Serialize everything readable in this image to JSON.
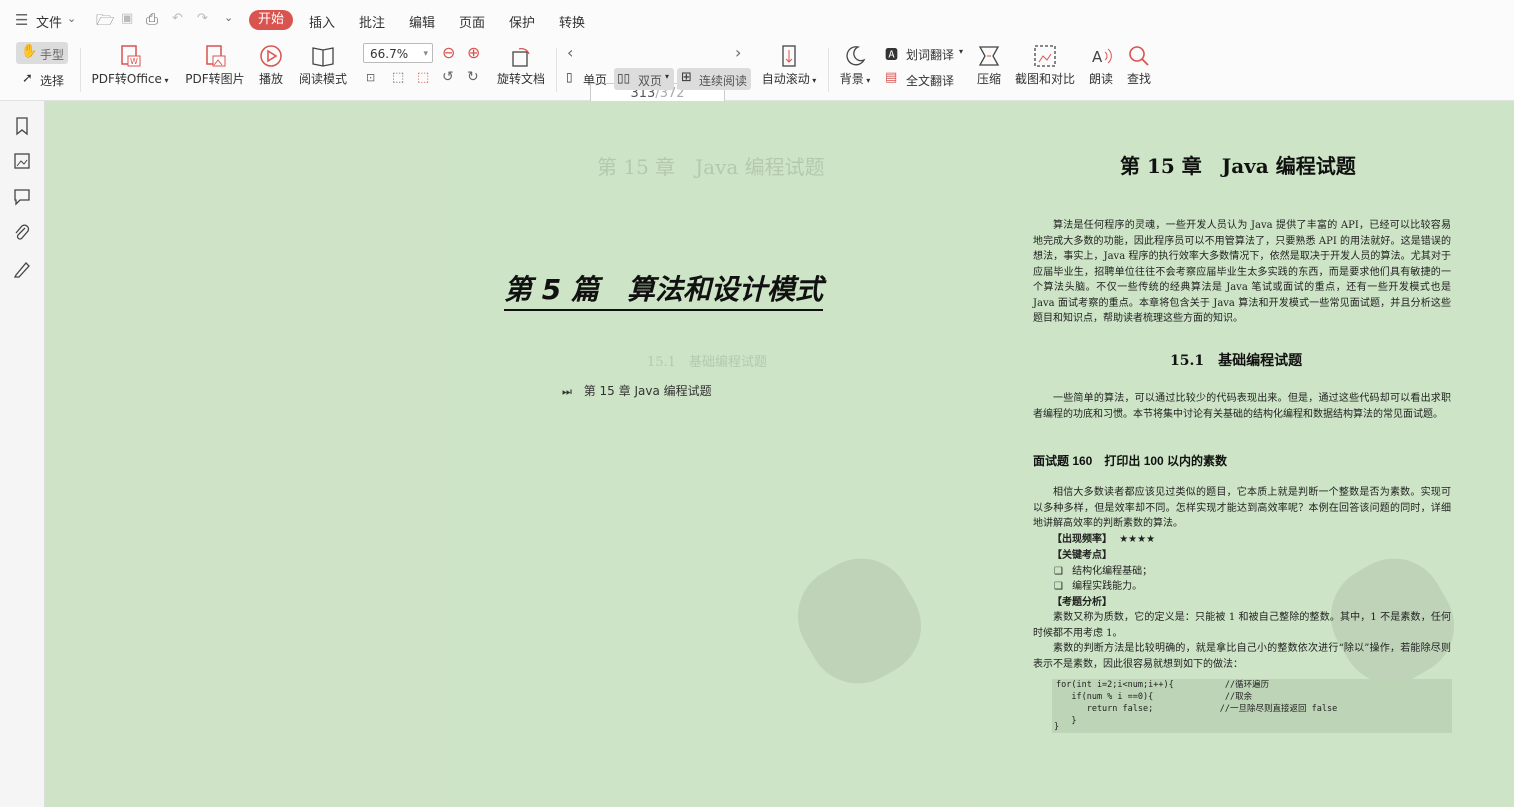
{
  "menu": {
    "file_label": "文件",
    "tabs": [
      "开始",
      "插入",
      "批注",
      "编辑",
      "页面",
      "保护",
      "转换"
    ]
  },
  "toolbar": {
    "hand": "手型",
    "select": "选择",
    "pdf_to_office": "PDF转Office",
    "pdf_to_image": "PDF转图片",
    "play": "播放",
    "read_mode": "阅读模式",
    "zoom": "66.7%",
    "rotate": "旋转文档",
    "page_current": "313",
    "page_total": "/372",
    "single": "单页",
    "double": "双页",
    "continuous": "连续阅读",
    "autoscroll": "自动滚动",
    "background": "背景",
    "word_translate": "划词翻译",
    "full_translate": "全文翻译",
    "compress": "压缩",
    "screenshot": "截图和对比",
    "read_aloud": "朗读",
    "find": "查找"
  },
  "left_page": {
    "part_title": "第 5 篇　算法和设计模式",
    "toc_item": "第 15 章  Java 编程试题"
  },
  "right_page": {
    "chapter_title": "第 15 章　Java 编程试题",
    "intro": "算法是任何程序的灵魂，一些开发人员认为 Java 提供了丰富的 API，已经可以比较容易地完成大多数的功能，因此程序员可以不用管算法了，只要熟悉 API 的用法就好。这是错误的想法，事实上，Java 程序的执行效率大多数情况下，依然是取决于开发人员的算法。尤其对于应届毕业生，招聘单位往往不会考察应届毕业生太多实践的东西，而是要求他们具有敏捷的一个算法头脑。不仅一些传统的经典算法是 Java 笔试或面试的重点，还有一些开发模式也是 Java 面试考察的重点。本章将包含关于 Java 算法和开发模式一些常见面试题，并且分析这些题目和知识点，帮助读者梳理这些方面的知识。",
    "section_title": "15.1　基础编程试题",
    "section_intro": "一些简单的算法，可以通过比较少的代码表现出来。但是，通过这些代码却可以看出求职者编程的功底和习惯。本节将集中讨论有关基础的结构化编程和数据结构算法的常见面试题。",
    "question_title": "面试题 160　打印出 100 以内的素数",
    "question_intro": "相信大多数读者都应该见过类似的题目，它本质上就是判断一个整数是否为素数。实现可以多种多样，但是效率却不同。怎样实现才能达到高效率呢？本例在回答该问题的同时，详细地讲解高效率的判断素数的算法。",
    "freq_label": "【出现频率】",
    "freq_stars": "★★★★",
    "key_label": "【关键考点】",
    "key_points": [
      "结构化编程基础；",
      "编程实践能力。"
    ],
    "analysis_label": "【考题分析】",
    "analysis1": "素数又称为质数，它的定义是：只能被 1 和被自己整除的整数。其中，1 不是素数，任何时候都不用考虑 1。",
    "analysis2": "素数的判断方法是比较明确的，就是拿比自己小的整数依次进行“除以”操作，若能除尽则表示不是素数，因此很容易就想到如下的做法：",
    "code": [
      "for(int i=2;i<num;i++){          //循环遍历",
      "   if(num % i ==0){              //取余",
      "      return false;             //一旦除尽则直接返回 false",
      "   }",
      "}"
    ]
  }
}
